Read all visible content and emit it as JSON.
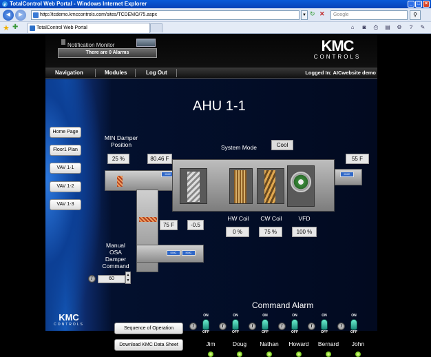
{
  "window": {
    "title": "TotalControl Web Portal - Windows Internet Explorer"
  },
  "address": {
    "url": "http://tcdemo.kmccontrols.com/sites/TCDEMO/75.aspx",
    "search_placeholder": "Google"
  },
  "tab": {
    "label": "TotalControl Web Portal"
  },
  "header": {
    "notification_title": "Notification Monitor",
    "alarms_text": "There are 0  Alarms",
    "logo_main": "KMC",
    "logo_sub": "CONTROLS"
  },
  "menu": {
    "items": [
      "Navigation",
      "Modules",
      "Log Out"
    ],
    "logged_in": "Logged In: AICwebsite demo"
  },
  "page": {
    "title": "AHU 1-1",
    "side_buttons": [
      "Home Page",
      "Floor1 Plan",
      "VAV 1-1",
      "VAV 1-2",
      "VAV 1-3"
    ],
    "min_damper_label": "MIN Damper\nPosition",
    "min_damper_value": "25 %",
    "return_temp": "80.46 F",
    "system_mode_label": "System Mode",
    "system_mode_value": "Cool",
    "supply_temp": "55 F",
    "osa_temp": "75 F",
    "osa_value2": "-0.5",
    "manual_osa_label": "Manual\nOSA\nDamper\nCommand",
    "manual_osa_value": "60",
    "hw_coil_label": "HW Coil",
    "hw_coil_value": "0 %",
    "cw_coil_label": "CW Coil",
    "cw_coil_value": "75 %",
    "vfd_label": "VFD",
    "vfd_value": "100 %",
    "command_alarm_title": "Command Alarm",
    "seq_button": "Sequence of Operation",
    "datasheet_button": "Download KMC Data Sheet",
    "switch_on": "ON",
    "switch_off": "OFF",
    "people": [
      "Jim",
      "Doug",
      "Nathan",
      "Howard",
      "Bernard",
      "John"
    ],
    "footer_logo_main": "KMC",
    "footer_logo_sub": "CONTROLS"
  }
}
